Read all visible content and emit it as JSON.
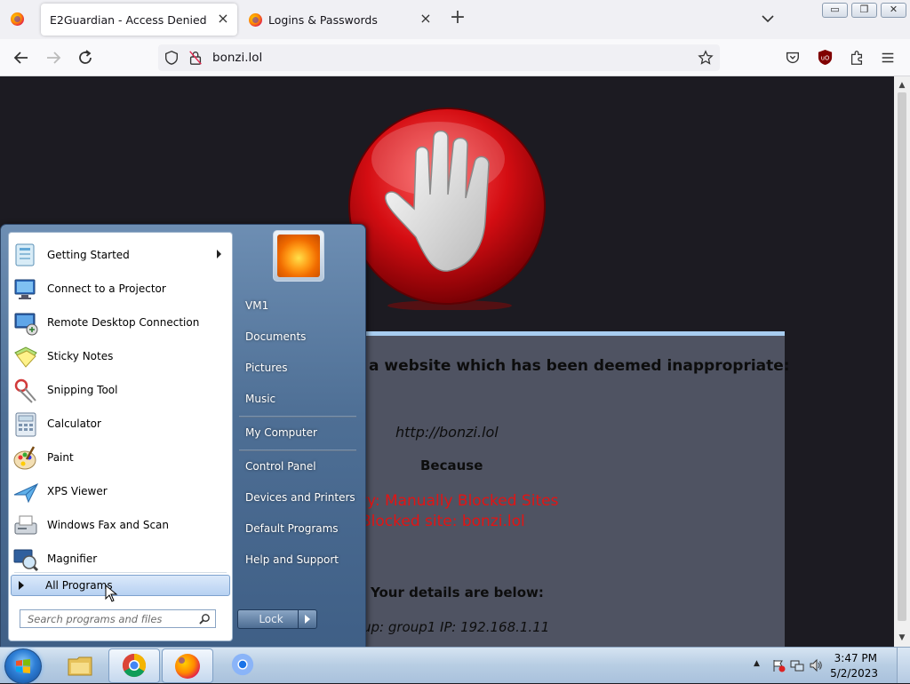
{
  "browser": {
    "tabs": [
      {
        "title": "E2Guardian - Access Denied",
        "active": true
      },
      {
        "title": "Logins & Passwords",
        "active": false
      }
    ],
    "url": "bonzi.lol"
  },
  "page": {
    "heading": "a website which has been deemed inappropriate:",
    "blocked_url": "http://bonzi.lol",
    "because": "Because",
    "category_text": "ry: Manually Blocked Sites",
    "blocked_site_text": "Blocked site: bonzi.lol",
    "details_heading": "Your details are below:",
    "group_ip": "up: group1   IP: 192.168.1.11"
  },
  "start_menu": {
    "programs": [
      {
        "label": "Getting Started",
        "icon": "getting-started-icon"
      },
      {
        "label": "Connect to a Projector",
        "icon": "projector-icon"
      },
      {
        "label": "Remote Desktop Connection",
        "icon": "remote-desktop-icon"
      },
      {
        "label": "Sticky Notes",
        "icon": "sticky-notes-icon"
      },
      {
        "label": "Snipping Tool",
        "icon": "snipping-tool-icon"
      },
      {
        "label": "Calculator",
        "icon": "calculator-icon"
      },
      {
        "label": "Paint",
        "icon": "paint-icon"
      },
      {
        "label": "XPS Viewer",
        "icon": "xps-viewer-icon"
      },
      {
        "label": "Windows Fax and Scan",
        "icon": "fax-scan-icon"
      },
      {
        "label": "Magnifier",
        "icon": "magnifier-icon"
      }
    ],
    "all_programs": "All Programs",
    "search_placeholder": "Search programs and files",
    "right_links": [
      "VM1",
      "Documents",
      "Pictures",
      "Music",
      "My Computer",
      "Control Panel",
      "Devices and Printers",
      "Default Programs",
      "Help and Support"
    ],
    "lock_label": "Lock"
  },
  "taskbar": {
    "time": "3:47 PM",
    "date": "5/2/2023"
  },
  "colors": {
    "page_bg": "#1c1b22",
    "block_box": "#4f5362",
    "block_box_top": "#a8cdf0",
    "alert_red": "#e21414",
    "stop_red": "#d40d12"
  }
}
